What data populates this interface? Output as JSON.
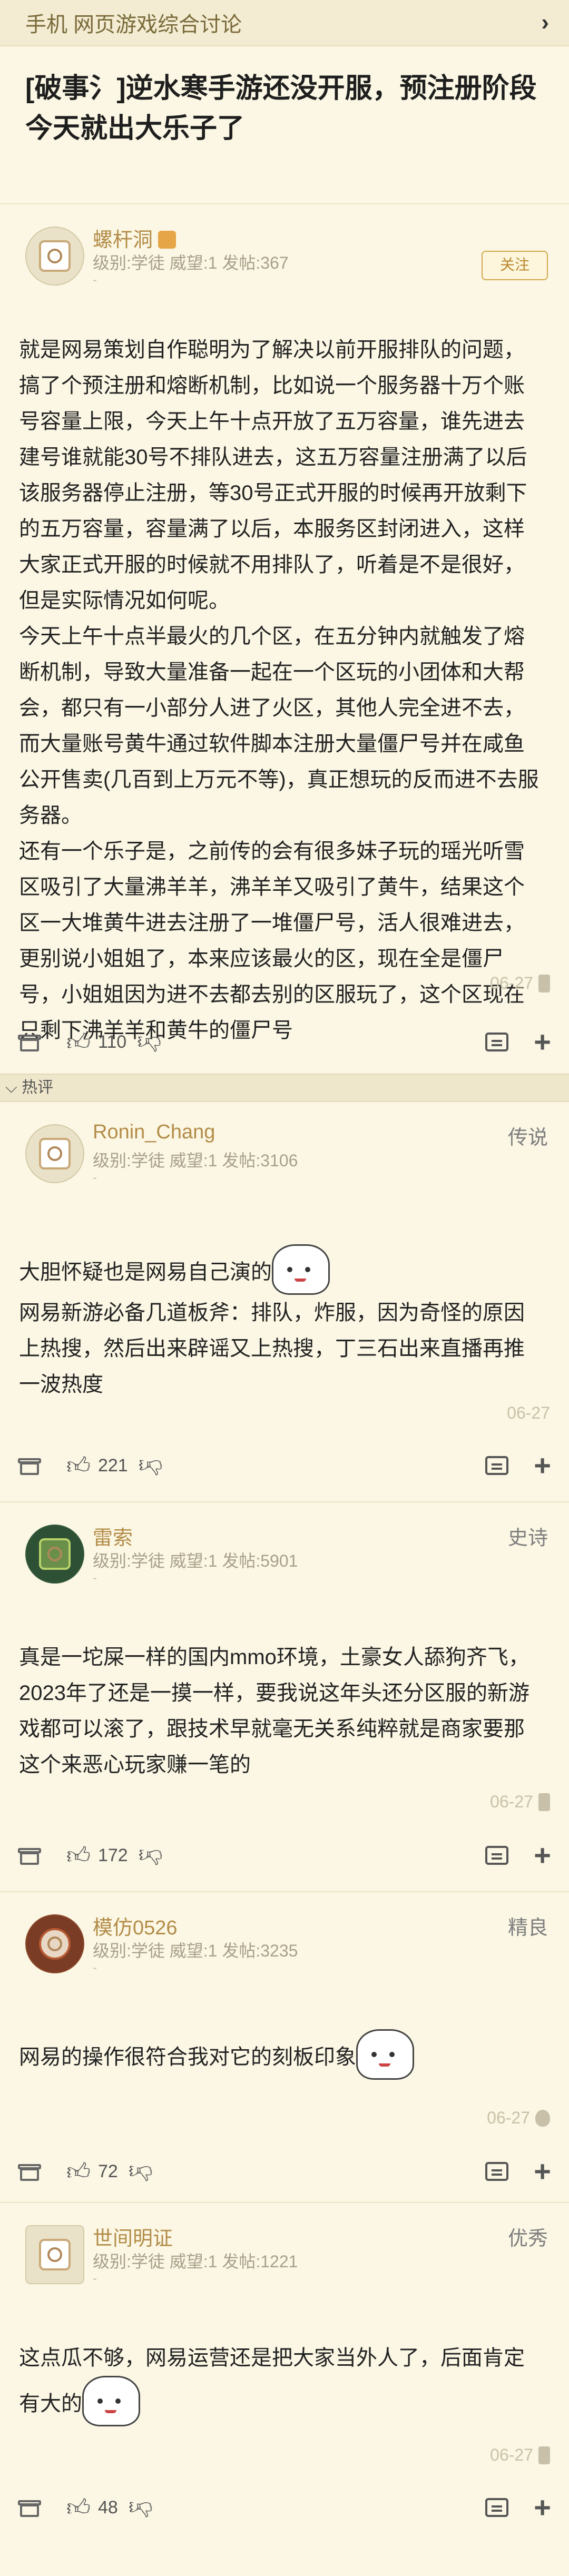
{
  "header": {
    "title": "手机 网页游戏综合讨论",
    "chevron": "chevron-right-icon"
  },
  "thread": {
    "title": "[破事氵]逆水寒手游还没开服，预注册阶段今天就出大乐子了"
  },
  "section": {
    "hot_label": "热评",
    "collapse_icon": "chevron-down-icon"
  },
  "posts": [
    {
      "username": "螺杆洞",
      "userinfo": "级别:学徒 威望:1 发帖:367",
      "dash": "-",
      "follow_label": "关注",
      "body": [
        "就是网易策划自作聪明为了解决以前开服排队的问题，搞了个预注册和熔断机制，比如说一个服务器十万个账号容量上限，今天上午十点开放了五万容量，谁先进去建号谁就能30号不排队进去，这五万容量注册满了以后该服务器停止注册，等30号正式开服的时候再开放剩下的五万容量，容量满了以后，本服务区封闭进入，这样大家正式开服的时候就不用排队了，听着是不是很好，但是实际情况如何呢。",
        "今天上午十点半最火的几个区，在五分钟内就触发了熔断机制，导致大量准备一起在一个区玩的小团体和大帮会，都只有一小部分人进了火区，其他人完全进不去，而大量账号黄牛通过软件脚本注册大量僵尸号并在咸鱼公开售卖(几百到上万元不等)，真正想玩的反而进不去服务器。",
        "还有一个乐子是，之前传的会有很多妹子玩的瑶光听雪区吸引了大量沸羊羊，沸羊羊又吸引了黄牛，结果这个区一大堆黄牛进去注册了一堆僵尸号，活人很难进去，更别说小姐姐了，本来应该最火的区，现在全是僵尸号，小姐姐因为进不去都去别的区服玩了，这个区现在只剩下沸羊羊和黄牛的僵尸号"
      ],
      "time": "06-27",
      "device_icon": "android-icon",
      "likes": "110"
    },
    {
      "username": "Ronin_Chang",
      "userinfo": "级别:学徒 威望:1 发帖:3106",
      "dash": "-",
      "badge": "传说",
      "body": [
        "大胆怀疑也是网易自己演的",
        "网易新游必备几道板斧：排队，炸服，因为奇怪的原因上热搜，然后出来辟谣又上热搜，丁三石出来直播再推一波热度"
      ],
      "time": "06-27",
      "likes": "221"
    },
    {
      "username": "雷索",
      "userinfo": "级别:学徒 威望:1 发帖:5901",
      "dash": "-",
      "badge": "史诗",
      "body": [
        "真是一坨屎一样的国内mmo环境，土豪女人舔狗齐飞，2023年了还是一摸一样，要我说这年头还分区服的新游戏都可以滚了，跟技术早就毫无关系纯粹就是商家要那这个来恶心玩家赚一笔的"
      ],
      "time": "06-27",
      "device_icon": "android-icon",
      "likes": "172"
    },
    {
      "username": "模仿0526",
      "userinfo": "级别:学徒 威望:1 发帖:3235",
      "dash": "-",
      "badge": "精良",
      "body": [
        "网易的操作很符合我对它的刻板印象"
      ],
      "time": "06-27",
      "device_icon": "apple-icon",
      "likes": "72"
    },
    {
      "username": "世间明证",
      "userinfo": "级别:学徒 威望:1 发帖:1221",
      "dash": "-",
      "badge": "优秀",
      "body": [
        "这点瓜不够，网易运营还是把大家当外人了，后面肯定有大的"
      ],
      "time": "06-27",
      "device_icon": "android-icon",
      "likes": "48"
    }
  ]
}
